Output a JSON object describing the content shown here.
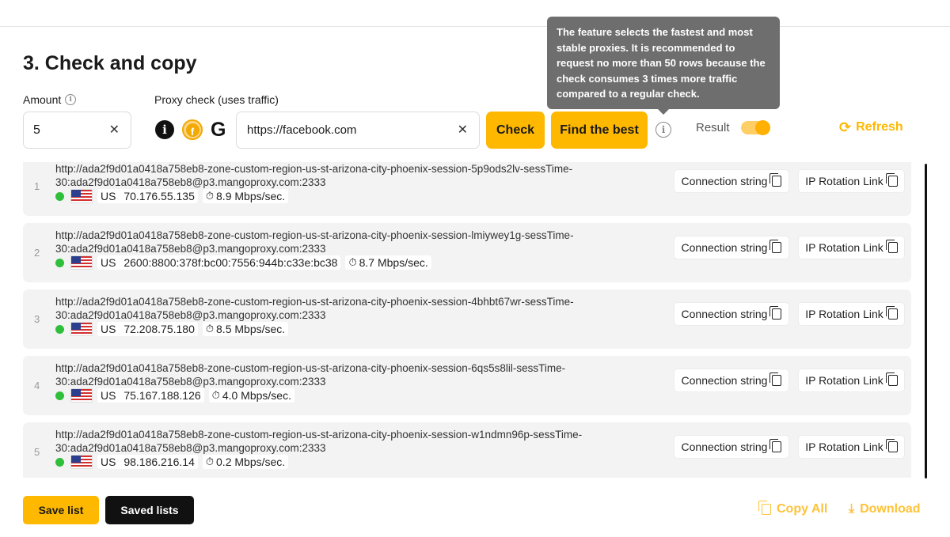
{
  "section": {
    "title": "3. Check and copy"
  },
  "amount": {
    "label": "Amount",
    "value": "5",
    "clear": "✕"
  },
  "proxy_check": {
    "label": "Proxy check (uses traffic)",
    "icons": {
      "info": "i",
      "facebook": "f",
      "google": "G"
    },
    "url": "https://facebook.com",
    "clear": "✕"
  },
  "buttons": {
    "check": "Check",
    "find_best": "Find the best",
    "save_list": "Save list",
    "saved_lists": "Saved lists"
  },
  "tooltip": {
    "text": "The feature selects the fastest and most stable proxies. It is recommended to request no more than 50 rows because the check consumes 3 times more traffic compared to a regular check."
  },
  "result": {
    "label": "Result",
    "on": true
  },
  "refresh": {
    "label": "Refresh",
    "icon": "⟳"
  },
  "row_buttons": {
    "connection": "Connection string",
    "rotation": "IP Rotation Link"
  },
  "rows": [
    {
      "num": "1",
      "url": "http://ada2f9d01a0418a758eb8-zone-custom-region-us-st-arizona-city-phoenix-session-5p9ods2lv-sessTime-30:ada2f9d01a0418a758eb8@p3.mangoproxy.com:2333",
      "country": "US",
      "ip": "70.176.55.135",
      "speed": "8.9 Mbps/sec."
    },
    {
      "num": "2",
      "url": "http://ada2f9d01a0418a758eb8-zone-custom-region-us-st-arizona-city-phoenix-session-lmiywey1g-sessTime-30:ada2f9d01a0418a758eb8@p3.mangoproxy.com:2333",
      "country": "US",
      "ip": "2600:8800:378f:bc00:7556:944b:c33e:bc38",
      "speed": "8.7 Mbps/sec."
    },
    {
      "num": "3",
      "url": "http://ada2f9d01a0418a758eb8-zone-custom-region-us-st-arizona-city-phoenix-session-4bhbt67wr-sessTime-30:ada2f9d01a0418a758eb8@p3.mangoproxy.com:2333",
      "country": "US",
      "ip": "72.208.75.180",
      "speed": "8.5 Mbps/sec."
    },
    {
      "num": "4",
      "url": "http://ada2f9d01a0418a758eb8-zone-custom-region-us-st-arizona-city-phoenix-session-6qs5s8lil-sessTime-30:ada2f9d01a0418a758eb8@p3.mangoproxy.com:2333",
      "country": "US",
      "ip": "75.167.188.126",
      "speed": "4.0 Mbps/sec."
    },
    {
      "num": "5",
      "url": "http://ada2f9d01a0418a758eb8-zone-custom-region-us-st-arizona-city-phoenix-session-w1ndmn96p-sessTime-30:ada2f9d01a0418a758eb8@p3.mangoproxy.com:2333",
      "country": "US",
      "ip": "98.186.216.14",
      "speed": "0.2 Mbps/sec."
    }
  ],
  "footer": {
    "copy_all": "Copy All",
    "download": "Download",
    "download_icon": "⤓"
  },
  "colors": {
    "accent": "#ffb800",
    "status_ok": "#2fbf3a",
    "tooltip_bg": "#6e6e6e"
  }
}
